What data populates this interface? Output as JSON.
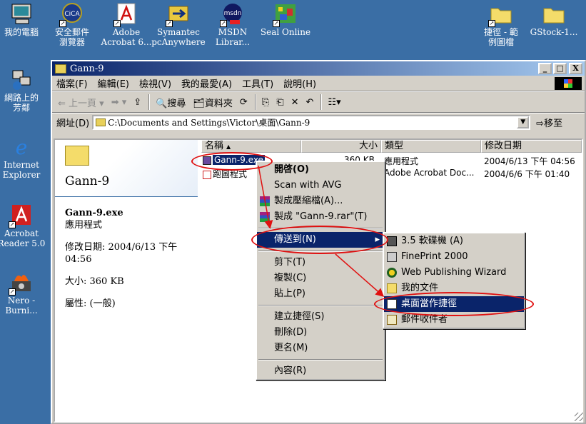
{
  "desktop": {
    "icons": [
      {
        "label1": "我的電腦",
        "label2": ""
      },
      {
        "label1": "安全郵件",
        "label2": "瀏覽器"
      },
      {
        "label1": "Adobe",
        "label2": "Acrobat 6..."
      },
      {
        "label1": "Symantec",
        "label2": "pcAnywhere"
      },
      {
        "label1": "MSDN",
        "label2": "Librar..."
      },
      {
        "label1": "Seal Online",
        "label2": ""
      },
      {
        "label1": "捷徑 - 範",
        "label2": "例圖檔"
      },
      {
        "label1": "GStock-1...",
        "label2": ""
      },
      {
        "label1": "網路上的",
        "label2": "芳鄰"
      },
      {
        "label1": "Internet",
        "label2": "Explorer"
      },
      {
        "label1": "Acrobat",
        "label2": "Reader 5.0"
      },
      {
        "label1": "Nero -",
        "label2": "Burni..."
      }
    ],
    "msdn_badge": "msdn",
    "cica_badge": "CiCA"
  },
  "window": {
    "title": "Gann-9",
    "min": "_",
    "max": "□",
    "close": "X",
    "menu": [
      "檔案(F)",
      "編輯(E)",
      "檢視(V)",
      "我的最愛(A)",
      "工具(T)",
      "說明(H)"
    ],
    "toolbar": {
      "back": "⇐ 上一頁 ▾",
      "forward": "➡ ▾",
      "up": "⇪",
      "search": "搜尋",
      "folders": "資料夾",
      "history": "⟳",
      "move": "⎘",
      "copy": "⎗",
      "delete": "✕",
      "undo": "↶",
      "views": "☷▾"
    },
    "address": {
      "label": "網址(D)",
      "value": "C:\\Documents and Settings\\Victor\\桌面\\Gann-9",
      "go": "移至"
    }
  },
  "left_pane": {
    "folder_name": "Gann-9",
    "file_name": "Gann-9.exe",
    "file_type": "應用程式",
    "modified_line1": "修改日期: 2004/6/13 下午",
    "modified_line2": "04:56",
    "size": "大小: 360 KB",
    "attributes": "屬性: (一般)"
  },
  "list": {
    "headers": {
      "name": "名稱",
      "size": "大小",
      "type": "類型",
      "modified": "修改日期"
    },
    "rows": [
      {
        "name": "Gann-9.exe",
        "size": "360 KB",
        "type": "應用程式",
        "modified": "2004/6/13 下午 04:56"
      },
      {
        "name": "跑圖程式",
        "size": "",
        "type": "Adobe Acrobat Doc...",
        "modified": "2004/6/6 下午 01:40"
      }
    ]
  },
  "context_menu": {
    "items": [
      "開啓(O)",
      "Scan with AVG",
      "製成壓縮檔(A)...",
      "製成 \"Gann-9.rar\"(T)",
      "傳送到(N)",
      "剪下(T)",
      "複製(C)",
      "貼上(P)",
      "建立捷徑(S)",
      "刪除(D)",
      "更名(M)",
      "內容(R)"
    ],
    "submenu_arrow": "▸"
  },
  "sendto_menu": {
    "items": [
      "3.5 軟碟機 (A)",
      "FinePrint 2000",
      "Web Publishing Wizard",
      "我的文件",
      "桌面當作捷徑",
      "郵件收件者"
    ]
  },
  "colors": {
    "desktop": "#3a6ea5",
    "selection": "#0a246a",
    "annotation": "#e01010"
  }
}
